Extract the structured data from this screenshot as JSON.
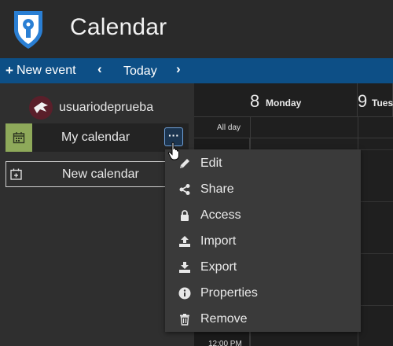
{
  "header": {
    "title": "Calendar",
    "logo_icon": "shield-key-icon"
  },
  "toolbar": {
    "new_event": "New event",
    "prev_icon": "chevron-left-icon",
    "today": "Today",
    "next_icon": "chevron-right-icon"
  },
  "sidebar": {
    "username": "usuariodeprueba",
    "calendar": {
      "name": "My calendar",
      "color": "#8ea95a",
      "more_label": "···"
    },
    "new_calendar": "New calendar"
  },
  "grid": {
    "days": [
      {
        "number": "8",
        "name": "Monday"
      },
      {
        "number": "9",
        "name": "Tues"
      }
    ],
    "allday": "All day",
    "time_bottom": "12:00 PM"
  },
  "menu": {
    "items": [
      {
        "label": "Edit",
        "icon": "pencil-icon"
      },
      {
        "label": "Share",
        "icon": "share-icon"
      },
      {
        "label": "Access",
        "icon": "lock-icon"
      },
      {
        "label": "Import",
        "icon": "upload-icon"
      },
      {
        "label": "Export",
        "icon": "download-icon"
      },
      {
        "label": "Properties",
        "icon": "info-icon"
      },
      {
        "label": "Remove",
        "icon": "trash-icon"
      }
    ]
  },
  "colors": {
    "toolbar": "#0d4f86",
    "accent_border": "#6fa0d8",
    "menu_bg": "#3a3a3a"
  }
}
